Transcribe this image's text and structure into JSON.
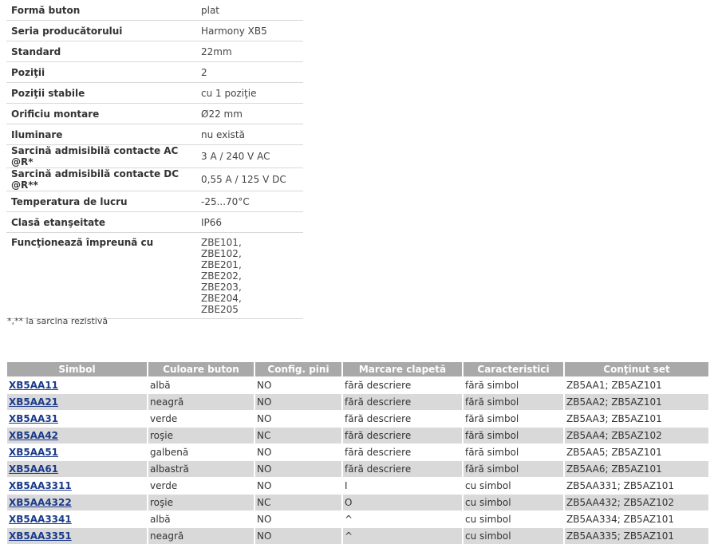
{
  "specs": [
    {
      "label": "Formă buton",
      "value": "plat"
    },
    {
      "label": "Seria producătorului",
      "value": "Harmony XB5"
    },
    {
      "label": "Standard",
      "value": "22mm"
    },
    {
      "label": "Poziţii",
      "value": "2"
    },
    {
      "label": "Poziţii stabile",
      "value": "cu 1 poziţie"
    },
    {
      "label": "Orificiu montare",
      "value": "Ø22 mm"
    },
    {
      "label": "Iluminare",
      "value": "nu există"
    },
    {
      "label": "Sarcină admisibilă contacte AC @R*",
      "value": "3 A / 240 V AC"
    },
    {
      "label": "Sarcină admisibilă contacte DC @R**",
      "value": "0,55 A / 125 V DC"
    },
    {
      "label": "Temperatura de lucru",
      "value": "-25...70°C"
    },
    {
      "label": "Clasă etanşeitate",
      "value": "IP66"
    }
  ],
  "works_with": {
    "label": "Funcţionează împreună cu",
    "items": [
      "ZBE101,",
      "ZBE102,",
      "ZBE201,",
      "ZBE202,",
      "ZBE203,",
      "ZBE204,",
      "ZBE205"
    ]
  },
  "footnote": "*,** la sarcina rezistivă",
  "products": {
    "headers": [
      "Simbol",
      "Culoare buton",
      "Config. pini",
      "Marcare clapetă",
      "Caracteristici",
      "Conţinut set"
    ],
    "rows": [
      [
        "XB5AA11",
        "albă",
        "NO",
        "fără descriere",
        "fără simbol",
        "ZB5AA1; ZB5AZ101"
      ],
      [
        "XB5AA21",
        "neagră",
        "NO",
        "fără descriere",
        "fără simbol",
        "ZB5AA2; ZB5AZ101"
      ],
      [
        "XB5AA31",
        "verde",
        "NO",
        "fără descriere",
        "fără simbol",
        "ZB5AA3; ZB5AZ101"
      ],
      [
        "XB5AA42",
        "roşie",
        "NC",
        "fără descriere",
        "fără simbol",
        "ZB5AA4; ZB5AZ102"
      ],
      [
        "XB5AA51",
        "galbenă",
        "NO",
        "fără descriere",
        "fără simbol",
        "ZB5AA5; ZB5AZ101"
      ],
      [
        "XB5AA61",
        "albastră",
        "NO",
        "fără descriere",
        "fără simbol",
        "ZB5AA6; ZB5AZ101"
      ],
      [
        "XB5AA3311",
        "verde",
        "NO",
        "I",
        "cu simbol",
        "ZB5AA331; ZB5AZ101"
      ],
      [
        "XB5AA4322",
        "roşie",
        "NC",
        "O",
        "cu simbol",
        "ZB5AA432; ZB5AZ102"
      ],
      [
        "XB5AA3341",
        "albă",
        "NO",
        "^",
        "cu simbol",
        "ZB5AA334; ZB5AZ101"
      ],
      [
        "XB5AA3351",
        "neagră",
        "NO",
        "^",
        "cu simbol",
        "ZB5AA335; ZB5AZ101"
      ]
    ]
  }
}
